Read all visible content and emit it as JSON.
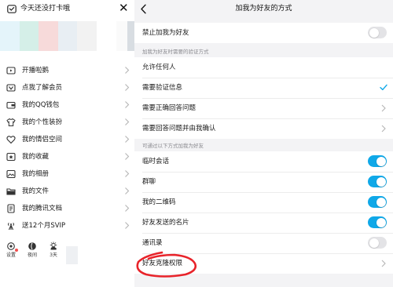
{
  "left_panel": {
    "header_text": "今天还没打卡哦",
    "menu": [
      {
        "label": "开播啦鹅",
        "icon": "live-icon"
      },
      {
        "label": "点我了解会员",
        "icon": "vip-icon"
      },
      {
        "label": "我的QQ钱包",
        "icon": "wallet-icon"
      },
      {
        "label": "我的个性装扮",
        "icon": "shirt-icon"
      },
      {
        "label": "我的情侣空间",
        "icon": "heart-icon"
      },
      {
        "label": "我的收藏",
        "icon": "star-icon"
      },
      {
        "label": "我的相册",
        "icon": "photo-icon"
      },
      {
        "label": "我的文件",
        "icon": "folder-icon"
      },
      {
        "label": "我的腾讯文档",
        "icon": "doc-icon"
      },
      {
        "label": "送12个月SVIP",
        "icon": "signal-icon"
      }
    ],
    "bottom": [
      {
        "label": "设置",
        "icon": "gear-icon"
      },
      {
        "label": "夜间",
        "icon": "moon-icon"
      },
      {
        "label": "3天",
        "icon": "weather-icon"
      }
    ]
  },
  "right_panel": {
    "title": "加我为好友的方式",
    "top_rows": [
      {
        "label": "禁止加我为好友",
        "toggle": false
      }
    ],
    "section1_label": "加我为好友时需要的验证方式",
    "verify_rows": [
      {
        "label": "允许任何人",
        "selected": false
      },
      {
        "label": "需要验证信息",
        "selected": true
      },
      {
        "label": "需要正确回答问题",
        "selected": false
      },
      {
        "label": "需要回答问题并由我确认",
        "selected": false
      }
    ],
    "section2_label": "可通过以下方式加我为好友",
    "method_rows": [
      {
        "label": "临时会话",
        "toggle": true
      },
      {
        "label": "群聊",
        "toggle": true
      },
      {
        "label": "我的二维码",
        "toggle": true
      },
      {
        "label": "好友发送的名片",
        "toggle": true
      },
      {
        "label": "通讯录",
        "toggle": false
      }
    ],
    "extra_rows": [
      {
        "label": "好友克隆权限"
      }
    ]
  },
  "colors": {
    "toggle_on": "#0fa8e8",
    "toggle_off": "#e3e3e6",
    "check": "#0fa8e8",
    "annotation": "#e8232a"
  }
}
